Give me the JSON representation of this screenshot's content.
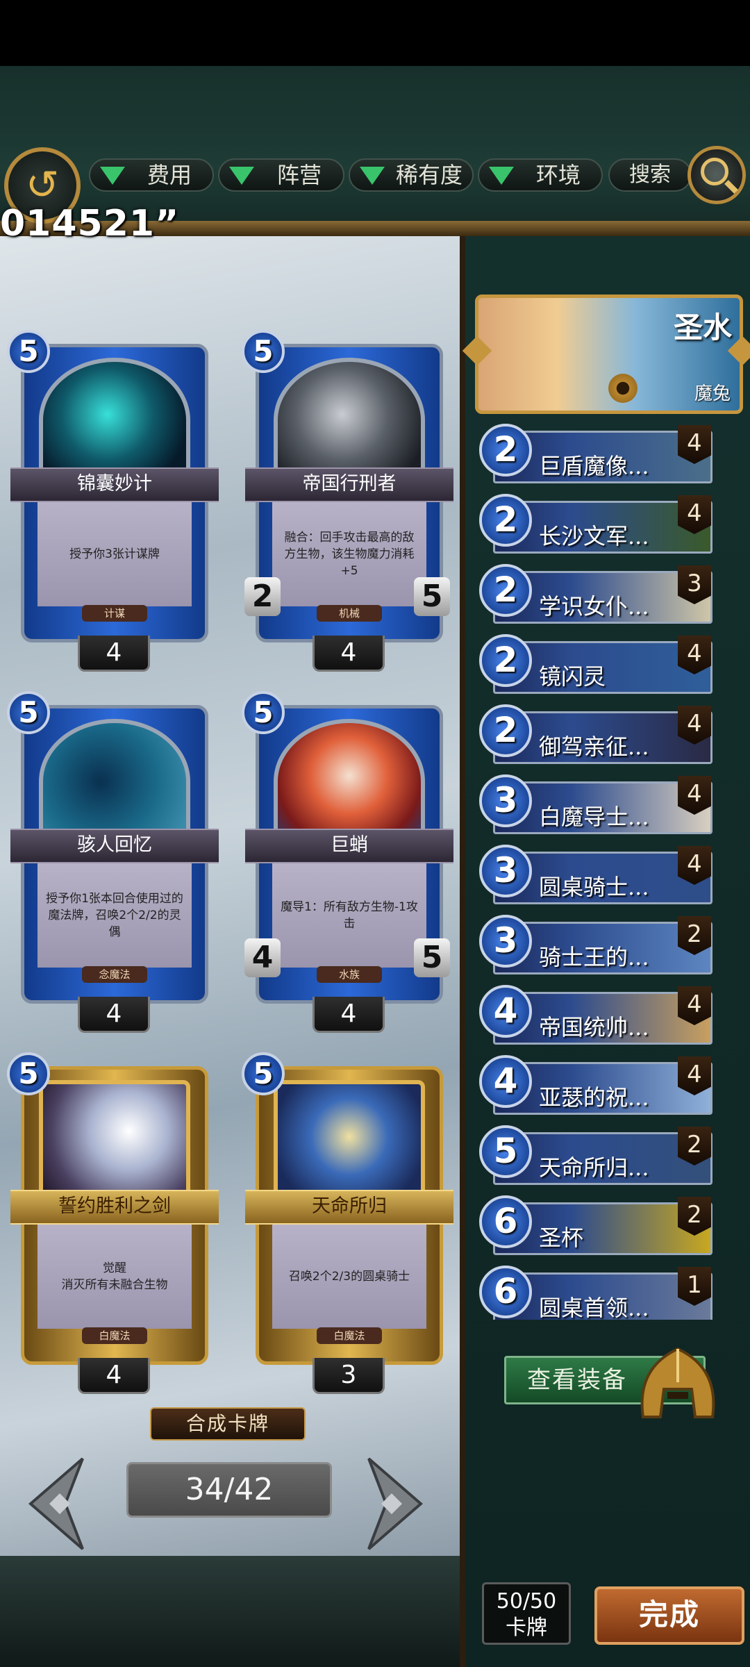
{
  "overlay_text": "014521”",
  "filters": [
    {
      "label": "费用"
    },
    {
      "label": "阵营"
    },
    {
      "label": "稀有度"
    },
    {
      "label": "环境"
    }
  ],
  "search_label": "搜索",
  "cards": [
    {
      "name": "锦囊妙计",
      "cost": "5",
      "desc": "授予你3张计谋牌",
      "type": "计谋",
      "count": "4",
      "atk": "",
      "hp": ""
    },
    {
      "name": "帝国行刑者",
      "cost": "5",
      "desc": "融合：回手攻击最高的敌方生物，该生物魔力消耗+5",
      "type": "机械",
      "count": "4",
      "atk": "2",
      "hp": "5"
    },
    {
      "name": "骇人回忆",
      "cost": "5",
      "desc": "授予你1张本回合使用过的魔法牌，召唤2个2/2的灵偶",
      "type": "念魔法",
      "count": "4",
      "atk": "",
      "hp": ""
    },
    {
      "name": "巨蛸",
      "cost": "5",
      "desc": "魔导1：所有敌方生物-1攻击",
      "type": "水族",
      "count": "4",
      "atk": "4",
      "hp": "5"
    },
    {
      "name": "誓约胜利之剑",
      "cost": "5",
      "desc": "觉醒\n消灭所有未融合生物",
      "type": "白魔法",
      "count": "4",
      "atk": "",
      "hp": ""
    },
    {
      "name": "天命所归",
      "cost": "5",
      "desc": "召唤2个2/3的圆桌骑士",
      "type": "白魔法",
      "count": "3",
      "atk": "",
      "hp": ""
    }
  ],
  "synthesize_label": "合成卡牌",
  "page_indicator": "34/42",
  "hero": {
    "name": "圣水",
    "subtitle": "魔兔"
  },
  "deck": [
    {
      "cost": "2",
      "name": "巨盾魔像...",
      "count": "4",
      "color": "#4b6f8a"
    },
    {
      "cost": "2",
      "name": "长沙文军...",
      "count": "4",
      "color": "#3a5a2a"
    },
    {
      "cost": "2",
      "name": "学识女仆...",
      "count": "3",
      "color": "#cfc6a8"
    },
    {
      "cost": "2",
      "name": "镜闪灵",
      "count": "4",
      "color": "#2f5f9a"
    },
    {
      "cost": "2",
      "name": "御驾亲征...",
      "count": "4",
      "color": "#2a2a44"
    },
    {
      "cost": "3",
      "name": "白魔导士...",
      "count": "4",
      "color": "#d8cfc0"
    },
    {
      "cost": "3",
      "name": "圆桌骑士...",
      "count": "4",
      "color": "#2e4e8a"
    },
    {
      "cost": "3",
      "name": "骑士王的...",
      "count": "2",
      "color": "#5d86c0"
    },
    {
      "cost": "4",
      "name": "帝国统帅...",
      "count": "4",
      "color": "#c8a060"
    },
    {
      "cost": "4",
      "name": "亚瑟的祝...",
      "count": "4",
      "color": "#8fb0d8"
    },
    {
      "cost": "5",
      "name": "天命所归...",
      "count": "2",
      "color": "#33507a"
    },
    {
      "cost": "6",
      "name": "圣杯",
      "count": "2",
      "color": "#c8a820"
    },
    {
      "cost": "6",
      "name": "圆桌首领...",
      "count": "1",
      "color": "#6a7a9a"
    }
  ],
  "equipment_label": "查看装备",
  "deck_count": {
    "value": "50/50",
    "label": "卡牌"
  },
  "done_label": "完成"
}
